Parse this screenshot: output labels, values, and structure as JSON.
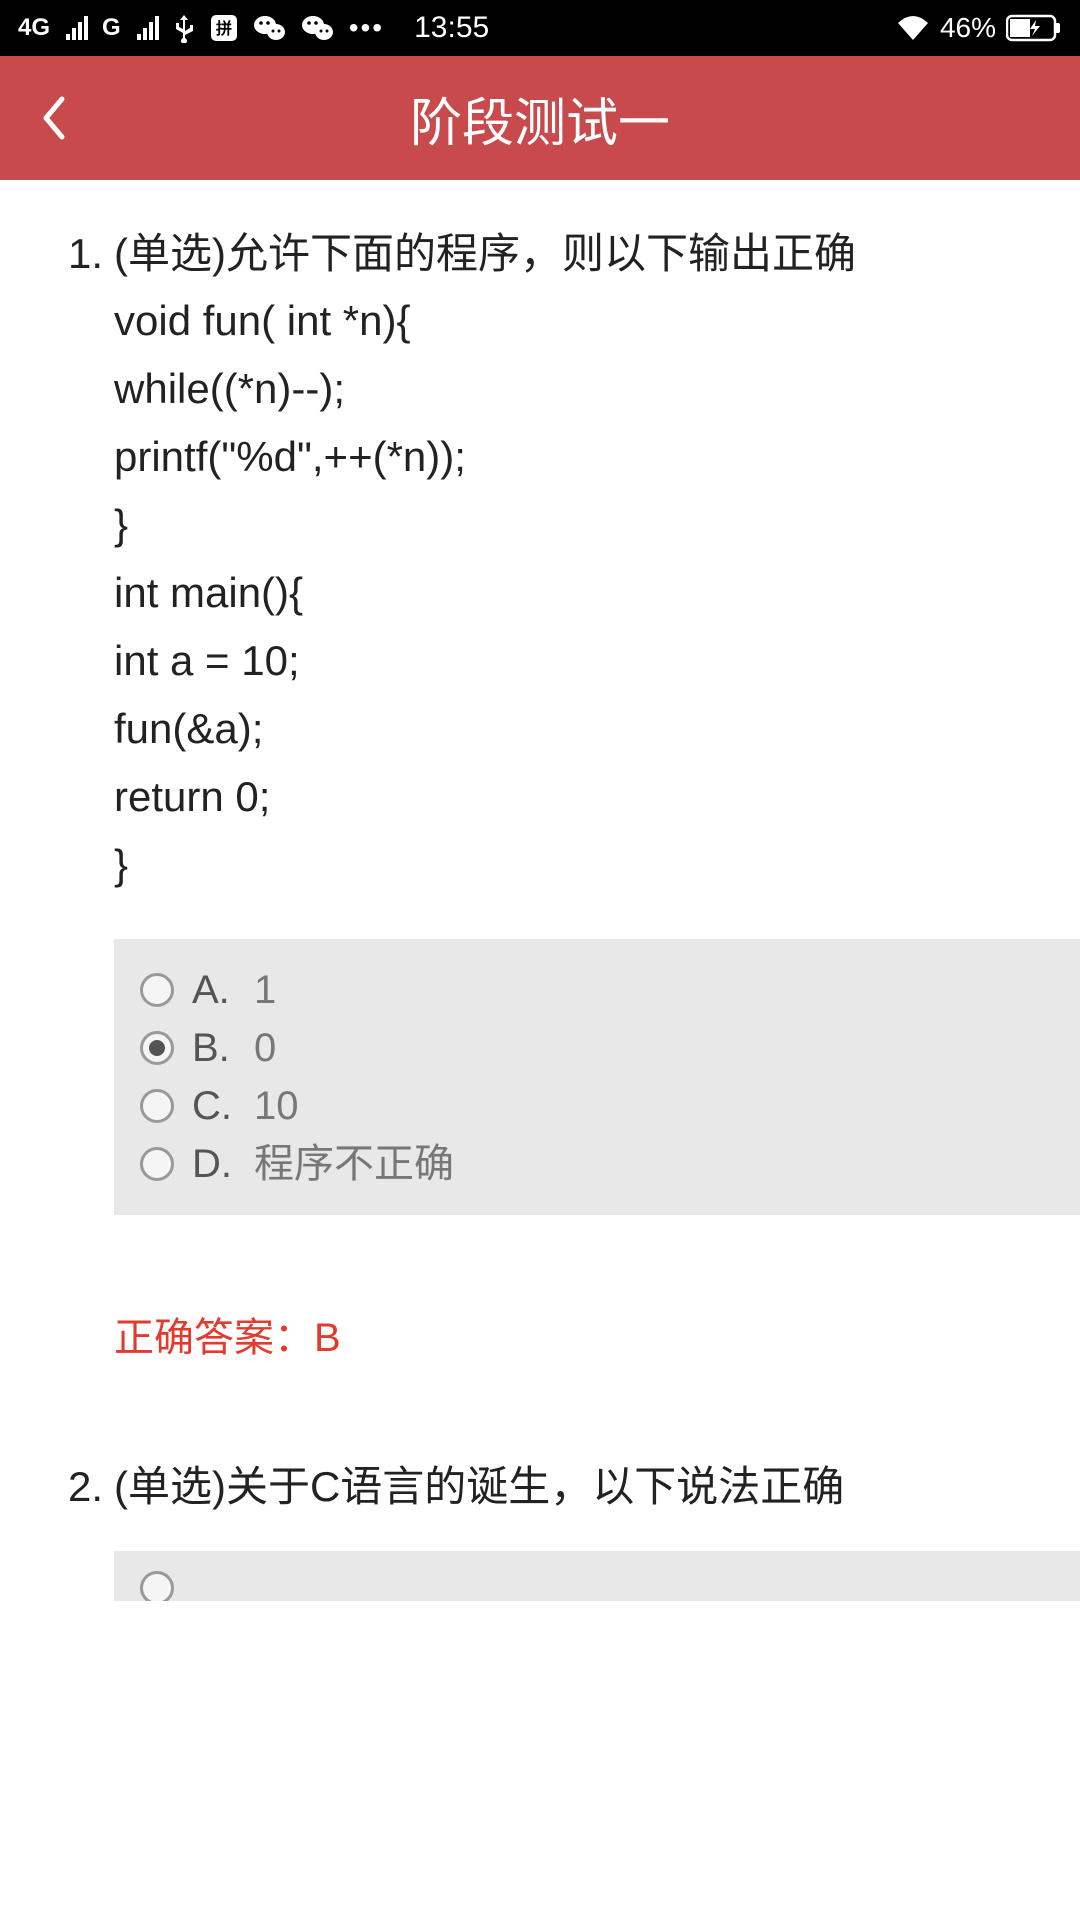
{
  "status": {
    "net1": "4G",
    "net2": "G",
    "dots": "•••",
    "time": "13:55",
    "battery_pct": "46%"
  },
  "header": {
    "title": "阶段测试一"
  },
  "q1": {
    "number": "1.",
    "prompt": "(单选)允许下面的程序，则以下输出正确",
    "code": [
      "void fun( int *n){",
      "while((*n)--);",
      "printf(\"%d\",++(*n));",
      "}",
      "int main(){",
      "int a = 10;",
      "fun(&a);",
      "return 0;",
      "}"
    ],
    "options": [
      {
        "letter": "A.",
        "text": "1",
        "selected": false
      },
      {
        "letter": "B.",
        "text": "0",
        "selected": true
      },
      {
        "letter": "C.",
        "text": "10",
        "selected": false
      },
      {
        "letter": "D.",
        "text": "程序不正确",
        "selected": false
      }
    ],
    "correct_label": "正确答案：B"
  },
  "q2": {
    "number": "2.",
    "prompt": "(单选)关于C语言的诞生，以下说法正确"
  }
}
